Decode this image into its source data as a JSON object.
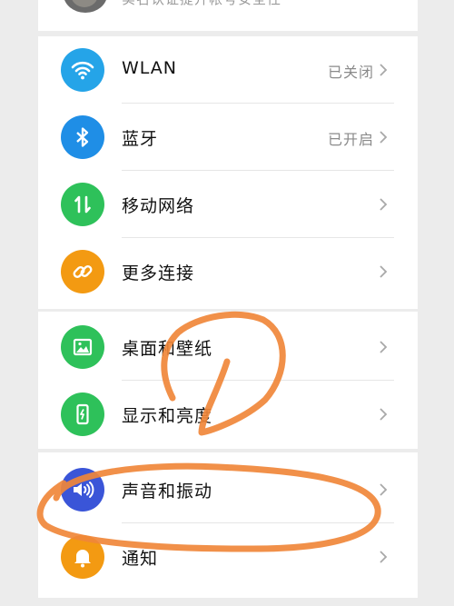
{
  "account": {
    "subtitle": "实名认证提升帐号安全性"
  },
  "sections": [
    {
      "items": [
        {
          "label": "WLAN",
          "value": "已关闭",
          "icon": "wifi-icon",
          "color": "#25a4e8"
        },
        {
          "label": "蓝牙",
          "value": "已开启",
          "icon": "bluetooth-icon",
          "color": "#1f8ee6"
        },
        {
          "label": "移动网络",
          "value": "",
          "icon": "mobile-data-icon",
          "color": "#2ec15a"
        },
        {
          "label": "更多连接",
          "value": "",
          "icon": "link-icon",
          "color": "#f39a12"
        }
      ]
    },
    {
      "items": [
        {
          "label": "桌面和壁纸",
          "value": "",
          "icon": "wallpaper-icon",
          "color": "#2ec15a"
        },
        {
          "label": "显示和亮度",
          "value": "",
          "icon": "display-icon",
          "color": "#2ec15a"
        }
      ]
    },
    {
      "items": [
        {
          "label": "声音和振动",
          "value": "",
          "icon": "speaker-icon",
          "color": "#3a55d8"
        },
        {
          "label": "通知",
          "value": "",
          "icon": "bell-icon",
          "color": "#f39a12"
        }
      ]
    }
  ],
  "annotation_color": "#f0873a"
}
